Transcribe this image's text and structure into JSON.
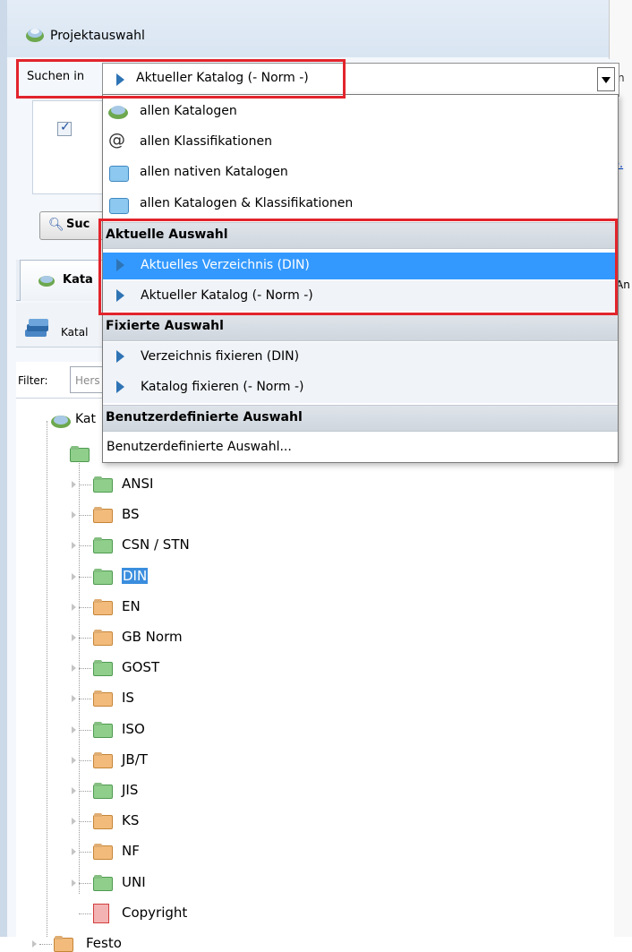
{
  "window": {
    "title": "Projektauswahl"
  },
  "search": {
    "label": "Suchen in",
    "combo_value": "Aktueller Katalog (- Norm -)",
    "right_letter": "n"
  },
  "background": {
    "search_button": "Suc",
    "link_fragment": "e.",
    "tab_label": "Kata",
    "tab_right_label": "An",
    "toolbar_label": "Katal",
    "filter_label": "Filter:",
    "filter_placeholder": "Hers",
    "root_label": "Kat"
  },
  "dropdown": {
    "items": [
      {
        "label": "allen Katalogen",
        "icon": "catalogs-icon"
      },
      {
        "label": "allen Klassifikationen",
        "icon": "at-icon"
      },
      {
        "label": "allen nativen Katalogen",
        "icon": "native-catalog-icon"
      },
      {
        "label": "allen Katalogen & Klassifikationen",
        "icon": "native-catalog-icon"
      }
    ],
    "groups": [
      {
        "header": "Aktuelle Auswahl",
        "items": [
          "Aktuelles Verzeichnis (DIN)",
          "Aktueller Katalog (- Norm -)"
        ]
      },
      {
        "header": "Fixierte Auswahl",
        "items": [
          "Verzeichnis fixieren (DIN)",
          "Katalog fixieren (- Norm -)"
        ]
      },
      {
        "header": "Benutzerdefinierte Auswahl",
        "items": [
          "Benutzerdefinierte Auswahl..."
        ]
      }
    ]
  },
  "tree": {
    "items": [
      {
        "label": "ANSI",
        "color": "green"
      },
      {
        "label": "BS",
        "color": "orange"
      },
      {
        "label": "CSN / STN",
        "color": "green"
      },
      {
        "label": "DIN",
        "color": "green",
        "selected": true
      },
      {
        "label": "EN",
        "color": "orange"
      },
      {
        "label": "GB Norm",
        "color": "orange"
      },
      {
        "label": "GOST",
        "color": "green"
      },
      {
        "label": "IS",
        "color": "orange"
      },
      {
        "label": "ISO",
        "color": "green"
      },
      {
        "label": "JB/T",
        "color": "orange"
      },
      {
        "label": "JIS",
        "color": "green"
      },
      {
        "label": "KS",
        "color": "orange"
      },
      {
        "label": "NF",
        "color": "orange"
      },
      {
        "label": "UNI",
        "color": "green"
      },
      {
        "label": "Copyright",
        "color": "red"
      },
      {
        "label": "Festo",
        "color": "orange"
      }
    ]
  },
  "colors": {
    "highlight": "#e2242c",
    "selection": "#3399ff",
    "accent_arrow": "#2e74b5"
  }
}
